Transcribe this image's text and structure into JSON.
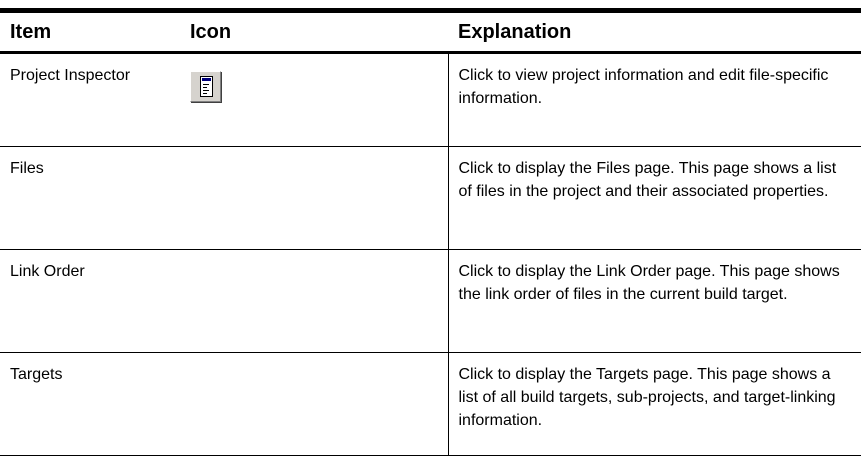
{
  "table": {
    "headers": {
      "item": "Item",
      "icon": "Icon",
      "explanation": "Explanation"
    },
    "rows": [
      {
        "item": "Project Inspector",
        "icon": "project-inspector-icon",
        "explanation": "Click to view project information and edit file-specific information."
      },
      {
        "item": "Files",
        "icon": "",
        "explanation": "Click to display the Files page. This page shows a list of files in the project and their associated properties."
      },
      {
        "item": "Link Order",
        "icon": "",
        "explanation": "Click to display the Link Order page. This page shows the link order of files in the current build target."
      },
      {
        "item": "Targets",
        "icon": "",
        "explanation": "Click to display the Targets page. This page shows a list of all build targets, sub-projects, and target-linking information."
      }
    ]
  },
  "colors": {
    "icon_face": "#d6d3ce",
    "icon_titlebar": "#00007b"
  }
}
